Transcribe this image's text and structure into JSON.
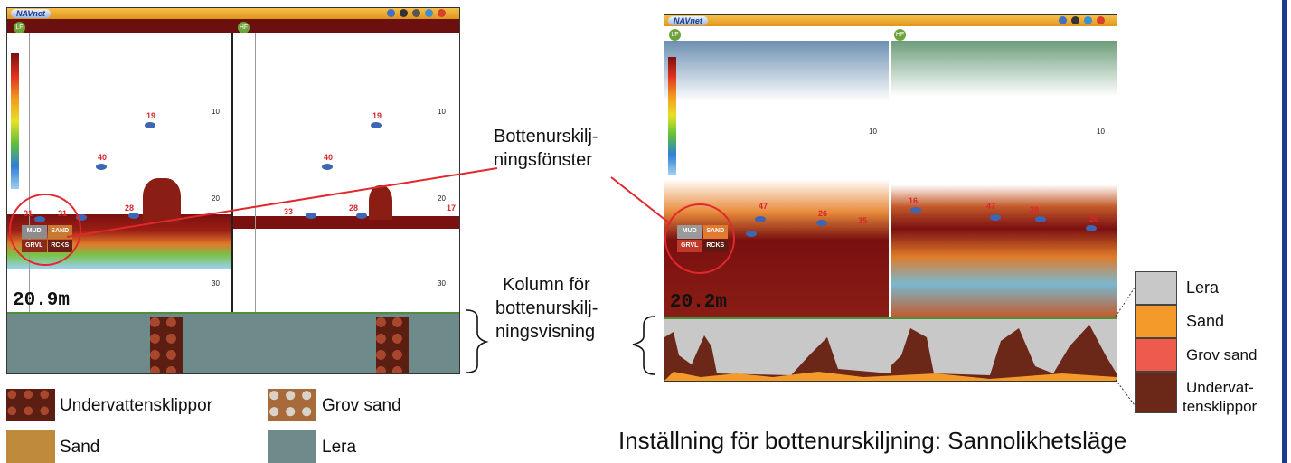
{
  "left_screen": {
    "logo": "NAVnet",
    "channel_left": "LF",
    "channel_right": "HF",
    "scale_ticks_left": [
      "10",
      "20",
      "30"
    ],
    "scale_ticks_right": [
      "10",
      "20",
      "30"
    ],
    "fish_labels": [
      "19",
      "40",
      "31",
      "31",
      "28",
      "19",
      "40",
      "33",
      "28",
      "17"
    ],
    "discrimination_window": [
      "MUD",
      "SAND",
      "GRVL",
      "RCKS"
    ],
    "depth_readout": "20.9m"
  },
  "right_screen": {
    "logo": "NAVnet",
    "channel_left": "LF",
    "channel_right": "HF",
    "scale_ticks_left": [
      "10"
    ],
    "scale_ticks_right": [
      "10"
    ],
    "fish_labels": [
      "47",
      "26",
      "35",
      "16",
      "47",
      "38",
      "26"
    ],
    "discrimination_window": [
      "MUD",
      "SAND",
      "GRVL",
      "RCKS"
    ],
    "depth_readout": "20.2m"
  },
  "annotations": {
    "window_label_line1": "Bottenurskilj-",
    "window_label_line2": "ningsfönster",
    "column_label_line1": "Kolumn för",
    "column_label_line2": "bottenurskilj-",
    "column_label_line3": "ningsvisning"
  },
  "legend_left": [
    {
      "label": "Undervattensklippor",
      "color": "#7b2e1e"
    },
    {
      "label": "Grov sand",
      "color": "#a88a6a"
    },
    {
      "label": "Sand",
      "color": "#c08a3c"
    },
    {
      "label": "Lera",
      "color": "#6f8a8a"
    }
  ],
  "legend_right": [
    {
      "label": "Lera",
      "color": "#c8c8c8"
    },
    {
      "label": "Sand",
      "color": "#f39a2a"
    },
    {
      "label": "Grov sand",
      "color": "#ee5a4c"
    },
    {
      "label_line1": "Undervat-",
      "label_line2": "tensklippor",
      "color": "#6b2818"
    }
  ],
  "caption": "Inställning för bottenurskiljning: Sannolikhetsläge"
}
